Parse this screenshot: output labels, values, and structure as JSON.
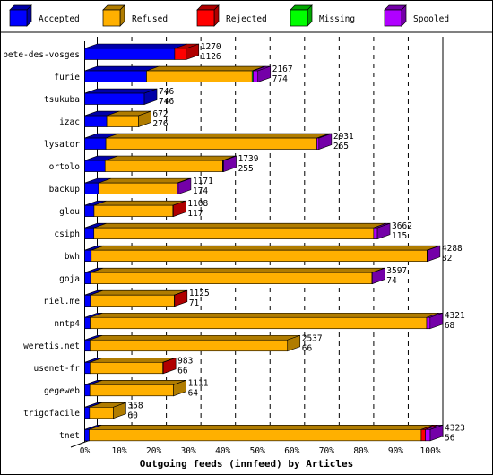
{
  "chart_data": {
    "type": "bar",
    "orientation": "horizontal",
    "stacked": true,
    "style": "3d",
    "xlabel": "Outgoing feeds (innfeed) by Articles",
    "xlim": [
      0,
      100
    ],
    "x_unit": "%",
    "x_ticks": [
      "0%",
      "10%",
      "20%",
      "30%",
      "40%",
      "50%",
      "60%",
      "70%",
      "80%",
      "90%",
      "100%"
    ],
    "grid": "vertical dashed",
    "legend_placement": "top",
    "series": [
      {
        "name": "Accepted",
        "color": "#0000ff",
        "side": "#0000a8"
      },
      {
        "name": "Refused",
        "color": "#ffb000",
        "side": "#b07c00"
      },
      {
        "name": "Rejected",
        "color": "#ff0000",
        "side": "#b00000"
      },
      {
        "name": "Missing",
        "color": "#00ff00",
        "side": "#00a800"
      },
      {
        "name": "Spooled",
        "color": "#b000ff",
        "side": "#7400a8"
      }
    ],
    "rows": [
      {
        "label": "bete-des-vosges",
        "total": 1270,
        "accepted_label": 1126,
        "values": [
          1126,
          0,
          144,
          0,
          0
        ]
      },
      {
        "label": "furie",
        "total": 2167,
        "accepted_label": 774,
        "values": [
          774,
          1320,
          0,
          13,
          60
        ]
      },
      {
        "label": "tsukuba",
        "total": 746,
        "accepted_label": 746,
        "values": [
          746,
          0,
          0,
          0,
          0
        ]
      },
      {
        "label": "izac",
        "total": 672,
        "accepted_label": 276,
        "values": [
          276,
          396,
          0,
          0,
          0
        ]
      },
      {
        "label": "lysator",
        "total": 2931,
        "accepted_label": 265,
        "values": [
          265,
          2640,
          0,
          0,
          26
        ]
      },
      {
        "label": "ortolo",
        "total": 1739,
        "accepted_label": 255,
        "values": [
          255,
          1470,
          0,
          6,
          8
        ]
      },
      {
        "label": "backup",
        "total": 1171,
        "accepted_label": 174,
        "values": [
          174,
          982,
          0,
          0,
          15
        ]
      },
      {
        "label": "glou",
        "total": 1108,
        "accepted_label": 117,
        "values": [
          117,
          986,
          5,
          0,
          0
        ]
      },
      {
        "label": "csiph",
        "total": 3662,
        "accepted_label": 115,
        "values": [
          115,
          3500,
          0,
          0,
          47
        ]
      },
      {
        "label": "bwh",
        "total": 4288,
        "accepted_label": 82,
        "values": [
          82,
          4200,
          0,
          0,
          6
        ]
      },
      {
        "label": "goja",
        "total": 3597,
        "accepted_label": 74,
        "values": [
          74,
          3520,
          0,
          0,
          3
        ]
      },
      {
        "label": "niel.me",
        "total": 1125,
        "accepted_label": 71,
        "values": [
          71,
          1050,
          4,
          0,
          0
        ]
      },
      {
        "label": "nntp4",
        "total": 4321,
        "accepted_label": 68,
        "values": [
          68,
          4210,
          0,
          0,
          43
        ]
      },
      {
        "label": "weretis.net",
        "total": 2537,
        "accepted_label": 66,
        "values": [
          66,
          2471,
          0,
          0,
          0
        ]
      },
      {
        "label": "usenet-fr",
        "total": 983,
        "accepted_label": 66,
        "values": [
          66,
          912,
          5,
          0,
          0
        ]
      },
      {
        "label": "gegeweb",
        "total": 1111,
        "accepted_label": 64,
        "values": [
          64,
          1047,
          0,
          0,
          0
        ]
      },
      {
        "label": "trigofacile",
        "total": 358,
        "accepted_label": 60,
        "values": [
          60,
          298,
          0,
          0,
          0
        ]
      },
      {
        "label": "tnet",
        "total": 4323,
        "accepted_label": 56,
        "values": [
          56,
          4154,
          52,
          0,
          61
        ]
      }
    ]
  }
}
